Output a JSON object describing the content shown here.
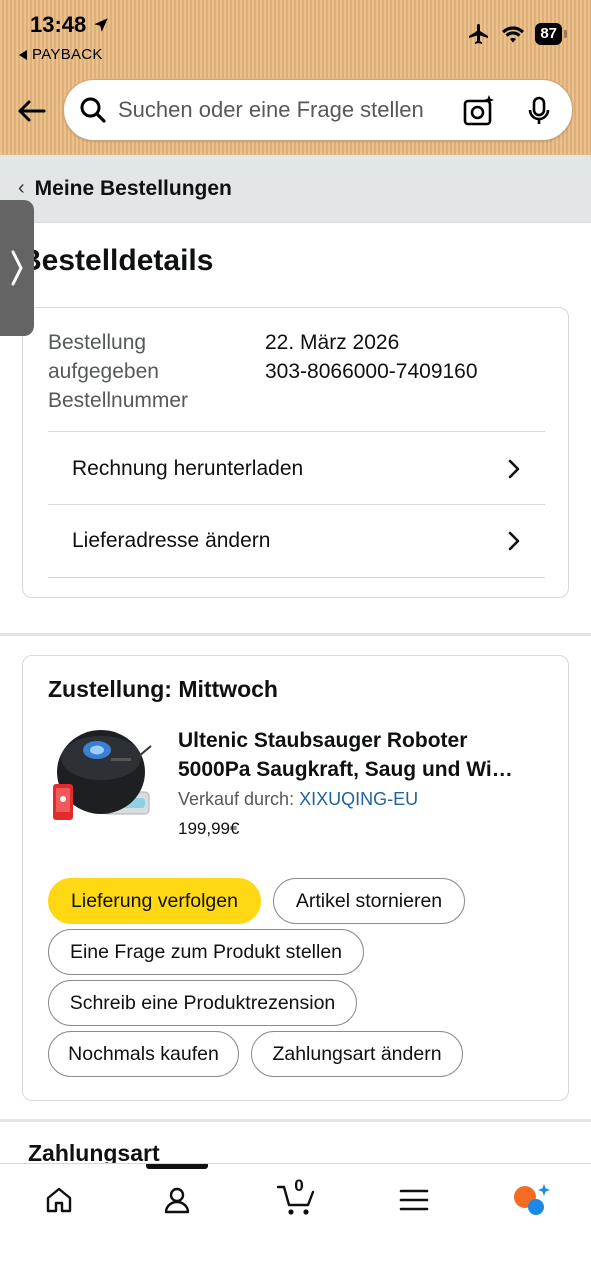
{
  "status_bar": {
    "time": "13:48",
    "back_app": "PAYBACK",
    "battery": "87"
  },
  "header": {
    "search_placeholder": "Suchen oder eine Frage stellen"
  },
  "breadcrumb": {
    "label": "Meine Bestellungen"
  },
  "page": {
    "title": "Bestelldetails"
  },
  "order": {
    "placed_label": "Bestellung aufgegeben",
    "placed_value": "22. März 2026",
    "number_label": "Bestellnummer",
    "number_value": "303-8066000-7409160",
    "links": [
      {
        "label": "Rechnung herunterladen"
      },
      {
        "label": "Lieferadresse ändern"
      }
    ]
  },
  "delivery": {
    "title": "Zustellung: Mittwoch",
    "product": {
      "title_line1": "Ultenic Staubsauger Roboter",
      "title_line2": "5000Pa Saugkraft, Saug und Wi…",
      "seller_prefix": "Verkauf durch:",
      "seller_name": "XIXUQING-EU",
      "price": "199,99€"
    },
    "actions": {
      "track": "Lieferung verfolgen",
      "cancel": "Artikel stornieren",
      "question": "Eine Frage zum Produkt stellen",
      "review": "Schreib eine Produktrezension",
      "buy_again": "Nochmals kaufen",
      "payment": "Zahlungsart ändern"
    }
  },
  "next_section": {
    "title": "Zahlungsart"
  },
  "tabbar": {
    "cart_count": "0",
    "items": [
      "home-icon",
      "account-icon",
      "cart-icon",
      "menu-icon",
      "ai-assistant-icon"
    ]
  },
  "colors": {
    "header_bg": "#e9b980",
    "primary_button": "#ffd814",
    "link": "#2162a1"
  }
}
